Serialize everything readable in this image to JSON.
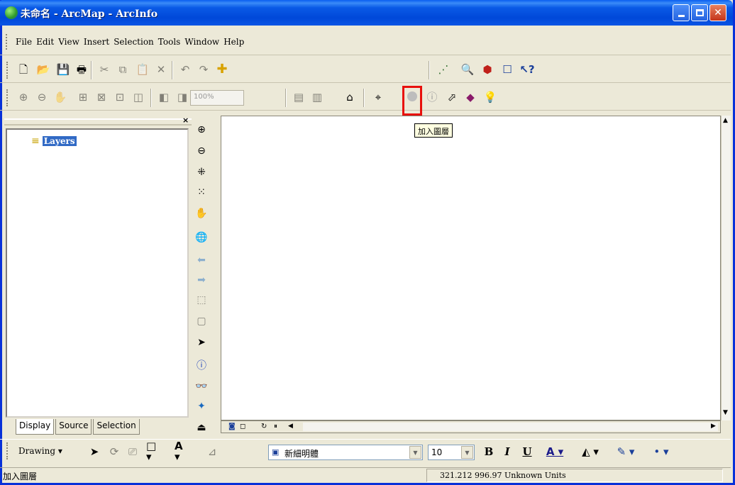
{
  "window": {
    "title": "未命名 - ArcMap - ArcInfo"
  },
  "menu": [
    "File",
    "Edit",
    "View",
    "Insert",
    "Selection",
    "Tools",
    "Window",
    "Help"
  ],
  "toolbar": {
    "scale_value": "",
    "zoom_value": "100%"
  },
  "toc": {
    "layers_label": "Layers",
    "close": "×",
    "tabs": [
      "Display",
      "Source",
      "Selection"
    ]
  },
  "tooltip": "加入圖層",
  "drawing": {
    "label": "Drawing",
    "font_name": "新細明體",
    "font_size": "10"
  },
  "status": {
    "message": "加入圖層",
    "coordinates": "321.212  996.97 Unknown Units"
  },
  "colors": {
    "titlebar": "#0a5ae6",
    "selection": "#316ac5",
    "highlight_box": "#e8100c",
    "tooltip_bg": "#ffffe1"
  },
  "icons": {
    "add_layer": "add-layer-icon",
    "add_data": "add-data-icon"
  }
}
